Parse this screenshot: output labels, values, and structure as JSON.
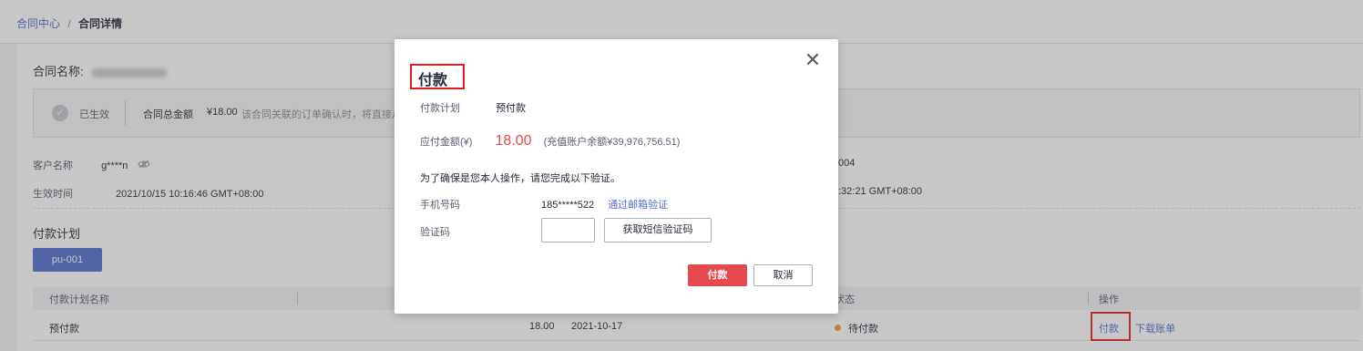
{
  "breadcrumb": {
    "root": "合同中心",
    "separator": "/",
    "current": "合同详情"
  },
  "contract": {
    "name_label": "合同名称:",
    "status": "已生效",
    "total_label": "合同总金额",
    "total_value": "¥18.00",
    "note": "该合同关联的订单确认时，将直接从"
  },
  "info": {
    "customer_label": "客户名称",
    "customer_value": "g****n",
    "effective_label": "生效时间",
    "effective_value": "2021/10/15 10:16:46 GMT+08:00",
    "right_value_1": "004",
    "right_value_2": ":32:21 GMT+08:00"
  },
  "plan": {
    "section_title": "付款计划",
    "tab_label": "pu-001",
    "columns": [
      "付款计划名称",
      "状态",
      "操作"
    ],
    "row": {
      "name": "预付款",
      "amount": "18.00",
      "date": "2021-10-17",
      "status": "待付款",
      "status_color": "#fa9841",
      "action_pay": "付款",
      "action_download": "下载账单"
    }
  },
  "dialog": {
    "title": "付款",
    "plan_label": "付款计划",
    "plan_value": "预付款",
    "amount_label": "应付金额(¥)",
    "amount_value": "18.00",
    "balance_note": "(充值账户余额¥39,976,756.51)",
    "verify_tip": "为了确保是您本人操作，请您完成以下验证。",
    "phone_label": "手机号码",
    "phone_value": "185*****522",
    "email_verify_link": "通过邮箱验证",
    "code_label": "验证码",
    "sms_button": "获取短信验证码",
    "confirm_button": "付款",
    "cancel_button": "取消"
  },
  "colors": {
    "accent": "#526ecc",
    "danger": "#e5484d",
    "highlight": "#e02020"
  }
}
